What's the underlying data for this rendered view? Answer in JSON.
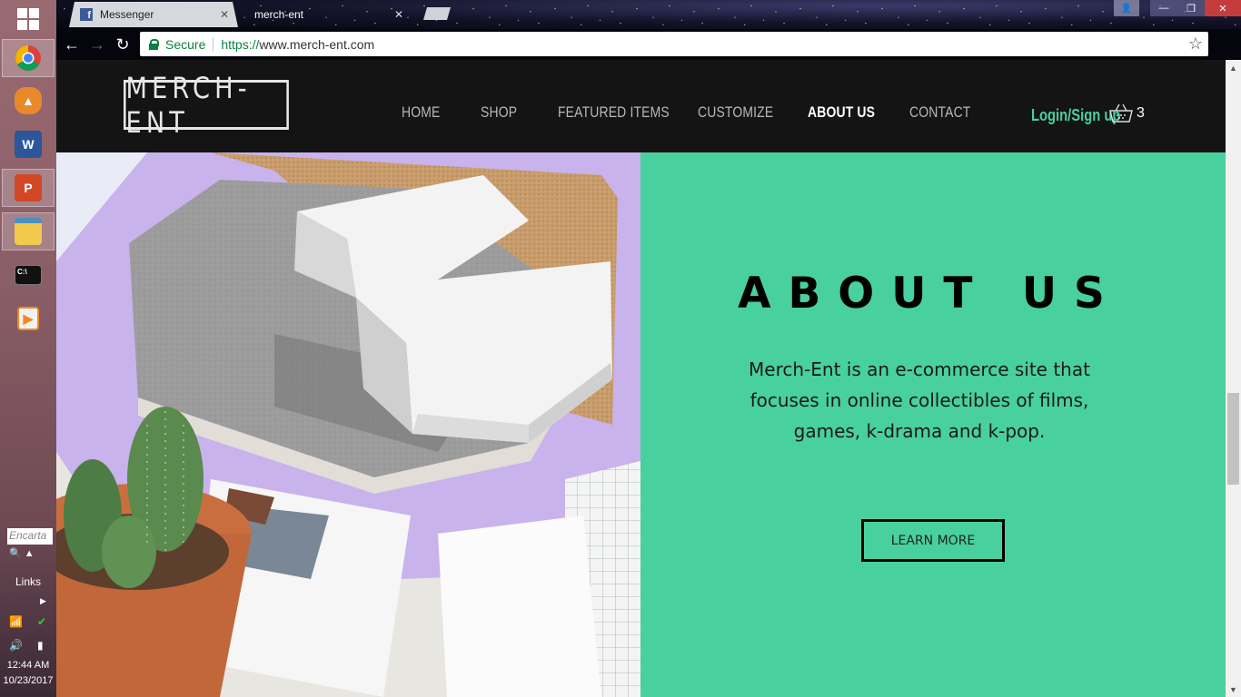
{
  "taskbar": {
    "search_placeholder": "Encarta",
    "links_label": "Links",
    "clock_time": "12:44 AM",
    "clock_date": "10/23/2017"
  },
  "browser": {
    "tabs": [
      {
        "label": "Messenger",
        "icon": "facebook-icon"
      },
      {
        "label": "merch-ent",
        "icon": ""
      }
    ],
    "secure_label": "Secure",
    "url_scheme": "https://",
    "url_host": "www.merch-ent.com"
  },
  "site": {
    "logo": "MERCH-ENT",
    "nav": [
      {
        "label": "HOME",
        "active": false
      },
      {
        "label": "SHOP",
        "active": false
      },
      {
        "label": "FEATURED ITEMS",
        "active": false
      },
      {
        "label": "CUSTOMIZE",
        "active": false
      },
      {
        "label": "ABOUT US",
        "active": true
      },
      {
        "label": "CONTACT",
        "active": false
      }
    ],
    "login_label": "Login/Sign up",
    "cart_count": "3"
  },
  "about": {
    "title": "ABOUT US",
    "text": "Merch-Ent is an e-commerce site that focuses in online collectibles of films, games, k-drama and k-pop.",
    "button_label": "LEARN MORE"
  },
  "colors": {
    "accent_green": "#49d09f",
    "header_bg": "#141414",
    "login_green": "#48cf9e"
  }
}
